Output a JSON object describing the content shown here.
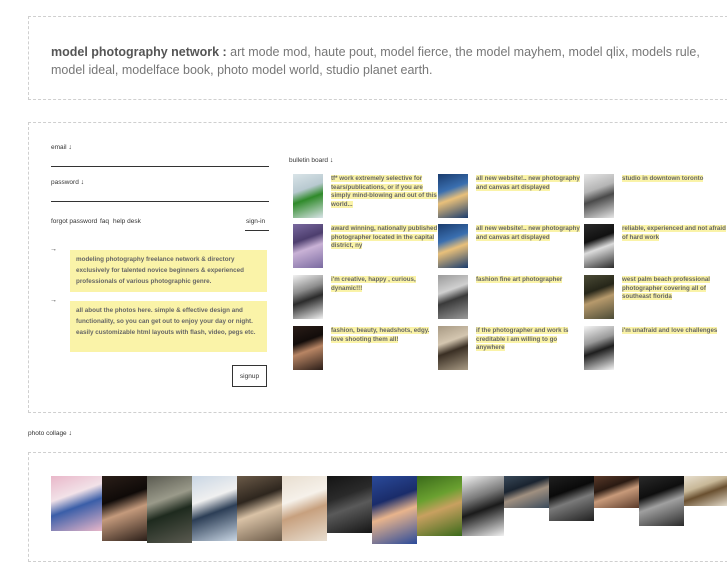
{
  "header": {
    "brand": "model photography network :",
    "sites": " art mode mod, haute pout, model fierce, the model mayhem, model qlix, models rule, model ideal, modelface book, photo model world, studio planet earth."
  },
  "login": {
    "email_label": "email",
    "password_label": "password",
    "forgot_password": "forgot password",
    "faq": "faq",
    "help_desk": "help desk",
    "sign_in": "sign-in",
    "arrow": "↓",
    "bullet": "→"
  },
  "info_boxes": [
    "modeling photography freelance network & directory exclusively for talented novice beginners & experienced professionals of various photographic genre.",
    "all about the photos here. simple & effective design and functionality, so you can get out to enjoy your day or night. easily customizable html layouts with flash, video, pegs etc."
  ],
  "signup_label": "signup",
  "bulletin": {
    "title": "bulletin board",
    "posts": [
      {
        "text": "tf* work extremely selective for tears/publications, or if you are simply mind-blowing and out of this world...",
        "colors": [
          "#d9e4e8",
          "#2f8a2a",
          "#b8c9d0"
        ]
      },
      {
        "text": "all new website!.. new photography and canvas art displayed",
        "colors": [
          "#1a3c6e",
          "#e9c07a",
          "#3a6fb0"
        ]
      },
      {
        "text": "studio in downtown toronto",
        "colors": [
          "#e6e6e6",
          "#4a4a4a",
          "#b5b5b5"
        ]
      },
      {
        "text": "award winning, nationally published photographer located in the capital district, ny",
        "colors": [
          "#7a6aa0",
          "#c9b2d6",
          "#4d3e6e"
        ]
      },
      {
        "text": "all new website!.. new photography and canvas art displayed",
        "colors": [
          "#1a3c6e",
          "#e9c07a",
          "#3a6fb0"
        ]
      },
      {
        "text": "reliable, experienced and not afraid of hard work",
        "colors": [
          "#2a2a2a",
          "#dcdcdc",
          "#111111"
        ]
      },
      {
        "text": "i'm creative, happy , curious, dynamic!!!",
        "colors": [
          "#f2f2f2",
          "#2b2b2b",
          "#8c8c8c"
        ]
      },
      {
        "text": "fashion fine art photographer",
        "colors": [
          "#9a9a9a",
          "#3a3a3a",
          "#d0d0d0"
        ]
      },
      {
        "text": "west palm beach professional photographer covering all of southeast florida",
        "colors": [
          "#4b4b36",
          "#b79a6c",
          "#262619"
        ]
      },
      {
        "text": "fashion, beauty, headshots, edgy.  love shooting them all!",
        "colors": [
          "#2a1d18",
          "#b88564",
          "#120c0a"
        ]
      },
      {
        "text": "if the photographer and work is creditable i am willing to go anywhere",
        "colors": [
          "#a89a84",
          "#3a2f24",
          "#d4c6b0"
        ]
      },
      {
        "text": "i'm unafraid and love challenges",
        "colors": [
          "#f5f5f5",
          "#1e1e1e",
          "#9a9a9a"
        ]
      }
    ]
  },
  "collage": {
    "title": "photo collage",
    "images": [
      {
        "name": "collage-photo-1",
        "colors": [
          "#e9b7c9",
          "#3a5ea8",
          "#f2e2e8"
        ]
      },
      {
        "name": "collage-photo-2",
        "colors": [
          "#2a1e18",
          "#c49a7c",
          "#0f0a08"
        ]
      },
      {
        "name": "collage-photo-3",
        "colors": [
          "#5a5a50",
          "#1e2a1e",
          "#9a9a8a"
        ]
      },
      {
        "name": "collage-photo-4",
        "colors": [
          "#c9d6e4",
          "#2c3e56",
          "#f0f0f0"
        ]
      },
      {
        "name": "collage-photo-5",
        "colors": [
          "#6b5a48",
          "#d9c2a6",
          "#2e261e"
        ]
      },
      {
        "name": "collage-photo-6",
        "colors": [
          "#e8ded0",
          "#c7a07e",
          "#f6f1ea"
        ]
      },
      {
        "name": "collage-photo-7",
        "colors": [
          "#141414",
          "#5a5a5a",
          "#2a2a2a"
        ]
      },
      {
        "name": "collage-photo-8",
        "colors": [
          "#2a4a9a",
          "#e8b48c",
          "#1a2c6a"
        ]
      },
      {
        "name": "collage-photo-9",
        "colors": [
          "#3a6a1a",
          "#c8a060",
          "#6aa030"
        ]
      },
      {
        "name": "collage-photo-10",
        "colors": [
          "#f2f2f2",
          "#1a1a1a",
          "#7a7a7a"
        ]
      },
      {
        "name": "collage-photo-11",
        "colors": [
          "#3a4a5a",
          "#a09080",
          "#1a2430"
        ]
      },
      {
        "name": "collage-photo-12",
        "colors": [
          "#202020",
          "#7a7a7a",
          "#0a0a0a"
        ]
      },
      {
        "name": "collage-photo-13",
        "colors": [
          "#5a3a2a",
          "#c89a7a",
          "#2a1a12"
        ]
      },
      {
        "name": "collage-photo-14",
        "colors": [
          "#2a2a2a",
          "#a0a0a0",
          "#0e0e0e"
        ]
      },
      {
        "name": "collage-photo-15",
        "colors": [
          "#e8e0d0",
          "#6a5030",
          "#c8b898"
        ]
      },
      {
        "name": "collage-photo-16",
        "colors": [
          "#f4d8e0",
          "#2a2a2a",
          "#ffffff"
        ]
      }
    ]
  }
}
